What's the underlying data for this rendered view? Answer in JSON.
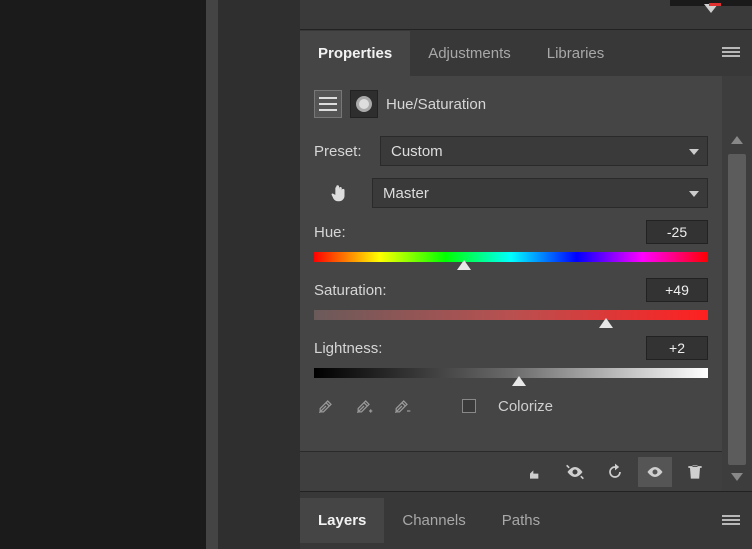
{
  "tabs": {
    "properties": "Properties",
    "adjustments": "Adjustments",
    "libraries": "Libraries"
  },
  "adjustment": {
    "type_label": "Hue/Saturation",
    "preset_label": "Preset:",
    "preset_value": "Custom",
    "range_value": "Master"
  },
  "sliders": {
    "hue": {
      "label": "Hue:",
      "value": "-25",
      "percent": 38
    },
    "saturation": {
      "label": "Saturation:",
      "value": "+49",
      "percent": 74
    },
    "lightness": {
      "label": "Lightness:",
      "value": "+2",
      "percent": 52
    }
  },
  "colorize_label": "Colorize",
  "bottom_tabs": {
    "layers": "Layers",
    "channels": "Channels",
    "paths": "Paths"
  }
}
